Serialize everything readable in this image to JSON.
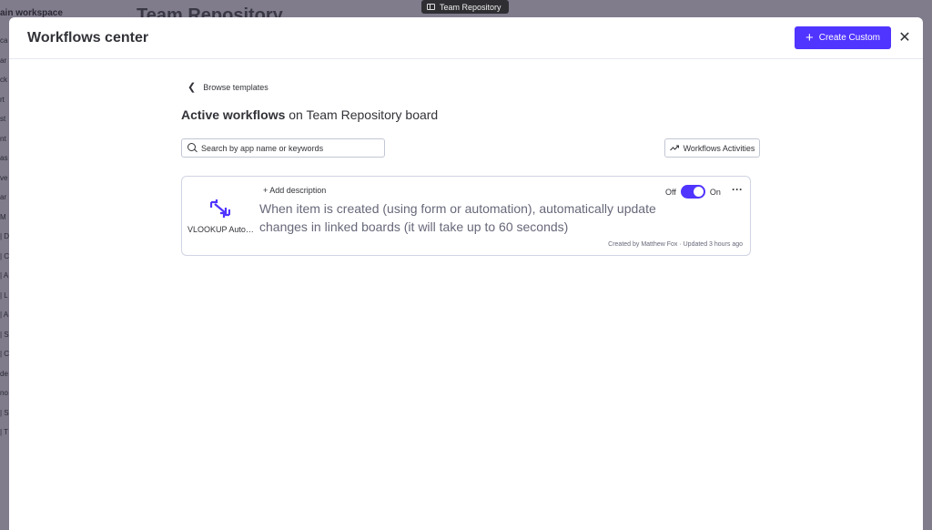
{
  "background": {
    "workspace": "ain workspace",
    "board_title": "Team Repository",
    "sidebar_fragments": [
      "ca",
      "ar",
      "ck",
      "rt",
      "st",
      "nt",
      "as",
      "ve",
      "ar",
      "M",
      "| D",
      "| C",
      "| A",
      "| L",
      "| A",
      "| S",
      "| C",
      "de",
      "no",
      "| S",
      "| T"
    ]
  },
  "window_chip": {
    "label": "Team Repository",
    "icon": "window-icon"
  },
  "modal": {
    "title": "Workflows center",
    "create_button": "Create Custom",
    "close_icon": "close-icon"
  },
  "page": {
    "back_label": "Browse templates",
    "heading_bold": "Active workflows",
    "heading_rest": " on Team Repository board",
    "search_placeholder": "Search by app name or keywords",
    "activities_button": "Workflows Activities"
  },
  "workflows": [
    {
      "app_name": "VLOOKUP Auto…",
      "app_icon": "vlookup-icon",
      "add_description": "+ Add description",
      "description": "When item is created (using form or automation), automatically update changes in linked boards (it will take up to 60 seconds)",
      "toggle_off_label": "Off",
      "toggle_on_label": "On",
      "enabled": true,
      "meta": "Created by Matthew Fox · Updated 3 hours ago"
    }
  ],
  "colors": {
    "primary": "#5034ff",
    "overlay": "#807c8c"
  }
}
